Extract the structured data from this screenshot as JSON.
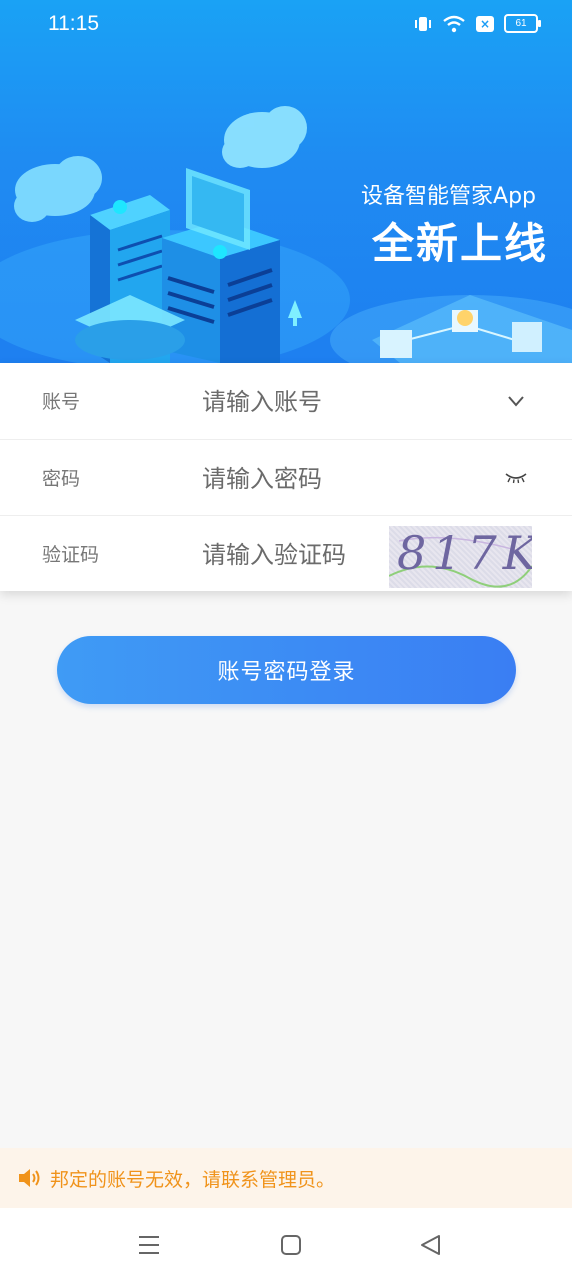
{
  "status_bar": {
    "time": "11:15",
    "battery": "61",
    "icons": [
      "vibrate-icon",
      "wifi-icon",
      "sim-x-icon",
      "battery-icon"
    ]
  },
  "banner": {
    "subtitle": "设备智能管家App",
    "title": "全新上线"
  },
  "form": {
    "account": {
      "label": "账号",
      "placeholder": "请输入账号",
      "icon": "chevron-down-icon"
    },
    "password": {
      "label": "密码",
      "placeholder": "请输入密码",
      "icon": "eye-closed-icon"
    },
    "captcha": {
      "label": "验证码",
      "placeholder": "请输入验证码",
      "image_text": "817K"
    }
  },
  "login_button": "账号密码登录",
  "notice": {
    "text": "邦定的账号无效，请联系管理员。",
    "color": "#f0931b",
    "icon": "speaker-icon"
  },
  "nav": {
    "icons": [
      "menu-icon",
      "home-square-icon",
      "back-triangle-icon"
    ]
  },
  "colors": {
    "banner": "#1e8cf2",
    "button": "#3a86f4",
    "notice_bg": "#fdf4ea"
  }
}
